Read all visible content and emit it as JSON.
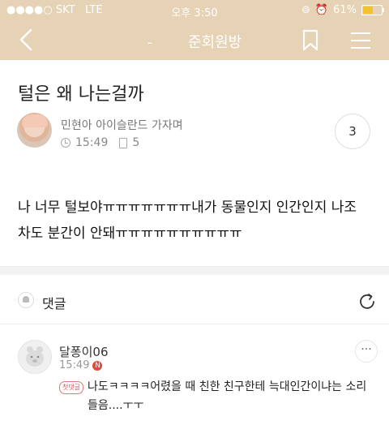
{
  "status_bar": {
    "carrier": "SKT",
    "network": "LTE",
    "time": "오후 3:50",
    "battery_percent": "61%",
    "battery_level": 0.61
  },
  "app_bar": {
    "dash": "-",
    "title": "준회원방"
  },
  "post": {
    "title": "털은 왜 나는걸까",
    "author": "민현아 아이슬란드 가자며",
    "time": "15:49",
    "views": "5",
    "comment_count": "3",
    "body_line1": "나 너무 털보야ㅠㅠㅠㅠㅠㅠㅠ내가 동물인지 인간인지 나조",
    "body_line2": "차도 분간이 안돼ㅠㅠㅠㅠㅠㅠㅠㅠㅠㅠ"
  },
  "comments_section": {
    "label": "댓글"
  },
  "comments": [
    {
      "author": "달퐁이06",
      "time": "15:49",
      "new_badge": "N",
      "first_badge": "첫댓글",
      "text": "나도ㅋㅋㅋㅋ어렸을 때 친한 친구한테 늑대인간이냐는 소리 들음....ㅜㅜ",
      "more": "···"
    }
  ],
  "colors": {
    "header_bg": "#e6d2b4",
    "accent_red": "#e04b3c"
  }
}
